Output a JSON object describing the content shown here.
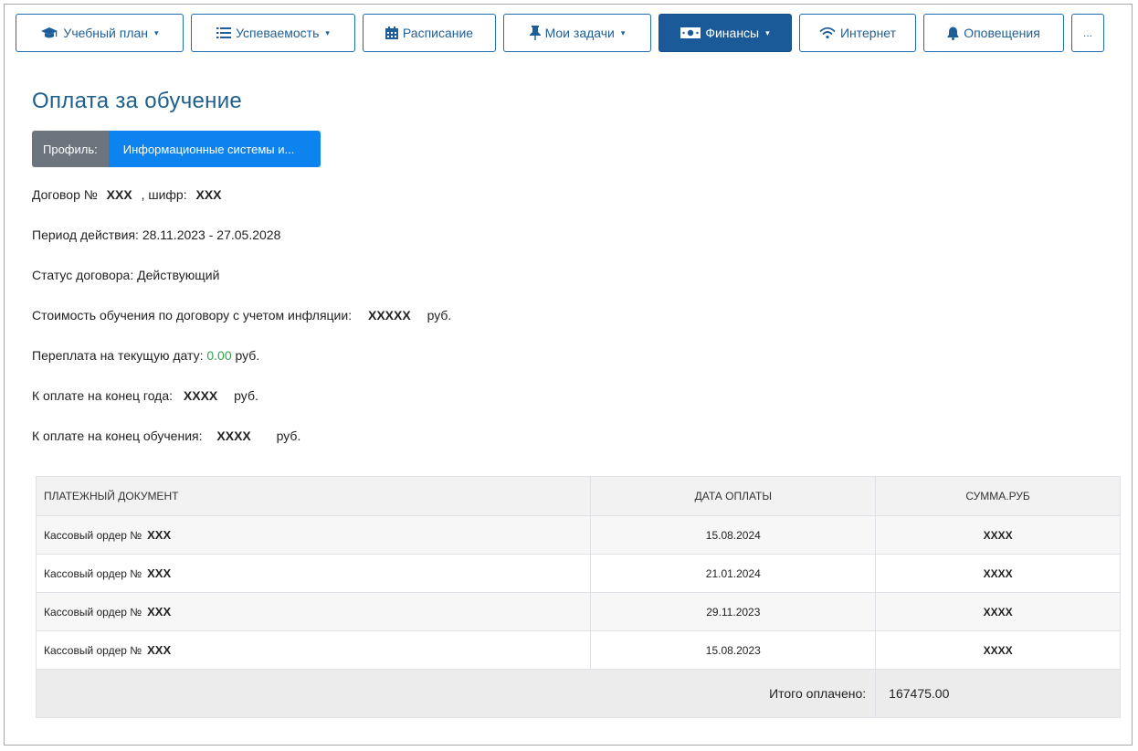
{
  "nav": {
    "items": [
      {
        "label": "Учебный план",
        "icon": "graduation-cap-icon",
        "dropdown": true
      },
      {
        "label": "Успеваемость",
        "icon": "list-icon",
        "dropdown": true
      },
      {
        "label": "Расписание",
        "icon": "calendar-icon",
        "dropdown": false
      },
      {
        "label": "Мои задачи",
        "icon": "pin-icon",
        "dropdown": true
      },
      {
        "label": "Финансы",
        "icon": "money-icon",
        "dropdown": true,
        "active": true
      },
      {
        "label": "Интернет",
        "icon": "wifi-icon",
        "dropdown": false
      },
      {
        "label": "Оповещения",
        "icon": "bell-icon",
        "dropdown": false
      },
      {
        "label": "...",
        "icon": null,
        "dropdown": false
      }
    ],
    "caret": "▾"
  },
  "page": {
    "title": "Оплата за обучение"
  },
  "profile": {
    "label": "Профиль:",
    "value": "Информационные системы и..."
  },
  "contract": {
    "number_prefix": "Договор №",
    "number": "XXX",
    "cipher_prefix": ", шифр:",
    "cipher": "XXX",
    "period_label": "Период действия:",
    "period": "28.11.2023 - 27.05.2028",
    "status_label": "Статус договора:",
    "status": "Действующий",
    "cost_label": "Стоимость обучения по договору с учетом инфляции:",
    "cost": "XXXXX",
    "currency": "руб.",
    "overpay_label": "Переплата на текущую дату:",
    "overpay": "0.00",
    "year_due_label": "К оплате на конец года:",
    "year_due": "XXXX",
    "end_due_label": "К оплате на конец обучения:",
    "end_due": "XXXX"
  },
  "payments": {
    "headers": [
      "ПЛАТЕЖНЫЙ ДОКУМЕНТ",
      "ДАТА ОПЛАТЫ",
      "СУММА.РУБ"
    ],
    "rows": [
      {
        "doc": "Кассовый ордер №",
        "doc_no": "XXX",
        "date": "15.08.2024",
        "sum": "XXXX"
      },
      {
        "doc": "Кассовый ордер №",
        "doc_no": "XXX",
        "date": "21.01.2024",
        "sum": "XXXX"
      },
      {
        "doc": "Кассовый ордер №",
        "doc_no": "XXX",
        "date": "29.11.2023",
        "sum": "XXXX"
      },
      {
        "doc": "Кассовый ордер №",
        "doc_no": "XXX",
        "date": "15.08.2023",
        "sum": "XXXX"
      }
    ],
    "total_label": "Итого оплачено:",
    "total": "167475.00"
  },
  "colors": {
    "accent": "#1a5a99",
    "profile_value_bg": "#0d83f0",
    "overpay_green": "#2ea34a"
  }
}
